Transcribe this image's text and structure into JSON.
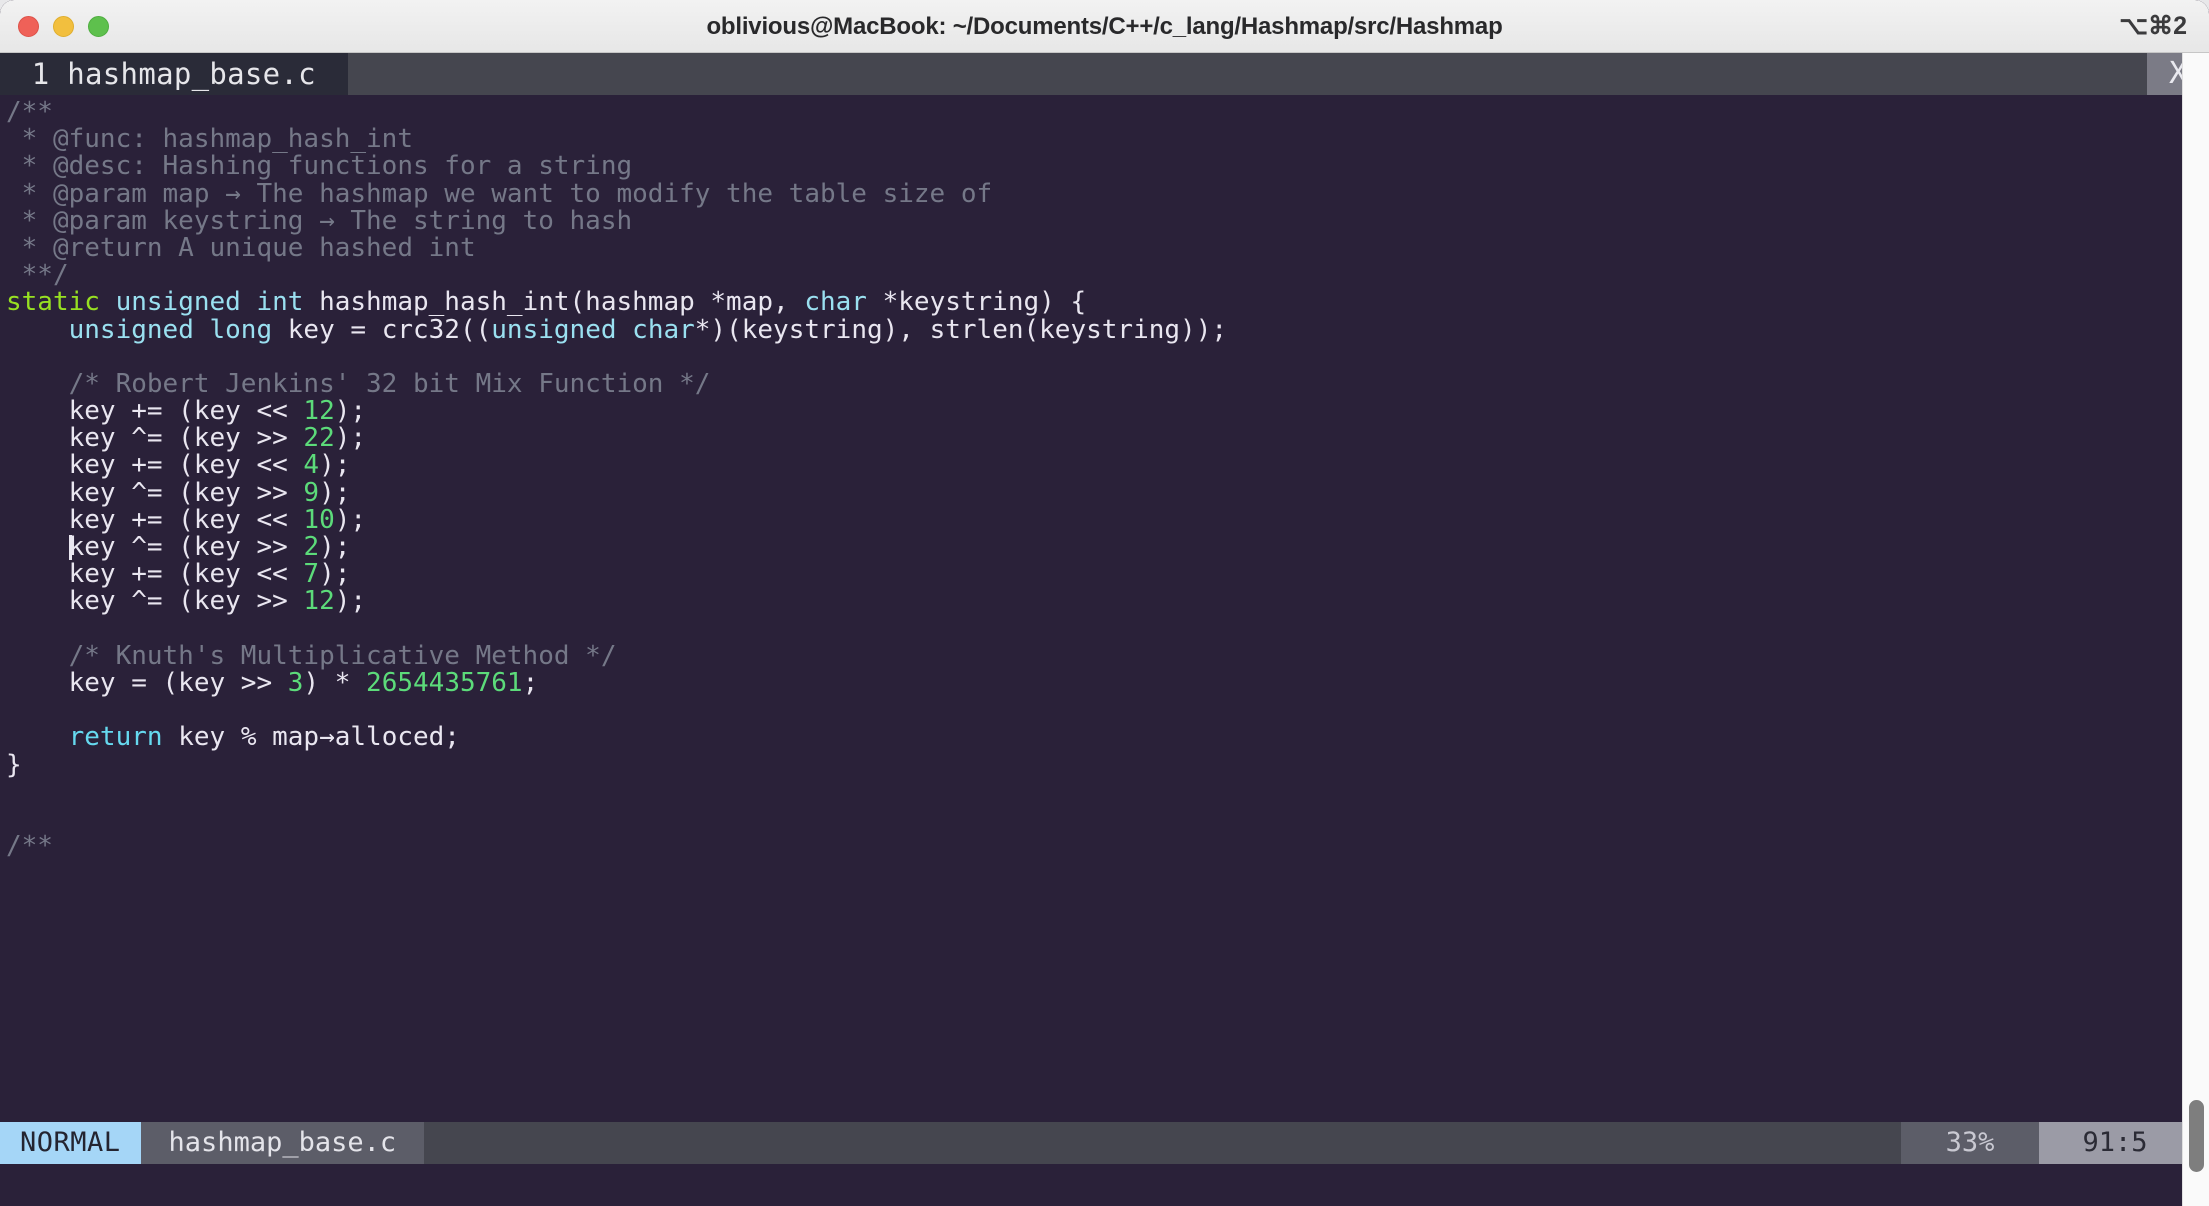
{
  "window": {
    "title": "oblivious@MacBook: ~/Documents/C++/c_lang/Hashmap/src/Hashmap",
    "shortcut": "⌥⌘2",
    "traffic_colors": {
      "close": "#ef6158",
      "minimize": "#f2bf3e",
      "zoom": "#5ec04d"
    },
    "background": "#2a2139"
  },
  "tabbar": {
    "tab_label": " 1 hashmap_base.c ",
    "close_label": "X"
  },
  "editor": {
    "lines": [
      {
        "segs": [
          {
            "t": "/**",
            "c": "cmt"
          }
        ]
      },
      {
        "segs": [
          {
            "t": " * @func: hashmap_hash_int",
            "c": "cmt"
          }
        ]
      },
      {
        "segs": [
          {
            "t": " * @desc: Hashing functions for a string",
            "c": "cmt"
          }
        ]
      },
      {
        "segs": [
          {
            "t": " * @param map → The hashmap we want to modify the table size of",
            "c": "cmt"
          }
        ]
      },
      {
        "segs": [
          {
            "t": " * @param keystring → The string to hash",
            "c": "cmt"
          }
        ]
      },
      {
        "segs": [
          {
            "t": " * @return A unique hashed int",
            "c": "cmt"
          }
        ]
      },
      {
        "segs": [
          {
            "t": " **/",
            "c": "cmt"
          }
        ]
      },
      {
        "segs": [
          {
            "t": "static",
            "c": "kw"
          },
          {
            "t": " ",
            "c": "fn"
          },
          {
            "t": "unsigned int",
            "c": "typ"
          },
          {
            "t": " hashmap_hash_int(hashmap *map, ",
            "c": "fn"
          },
          {
            "t": "char",
            "c": "typ"
          },
          {
            "t": " *keystring) {",
            "c": "fn"
          }
        ]
      },
      {
        "segs": [
          {
            "t": "    ",
            "c": "fn"
          },
          {
            "t": "unsigned long",
            "c": "typ"
          },
          {
            "t": " key = crc32((",
            "c": "fn"
          },
          {
            "t": "unsigned char",
            "c": "typ"
          },
          {
            "t": "*)(keystring), strlen(keystring));",
            "c": "fn"
          }
        ]
      },
      {
        "segs": [
          {
            "t": "",
            "c": "fn"
          }
        ]
      },
      {
        "segs": [
          {
            "t": "    /* Robert Jenkins' 32 bit Mix Function */",
            "c": "cmt"
          }
        ]
      },
      {
        "segs": [
          {
            "t": "    key += (key << ",
            "c": "fn"
          },
          {
            "t": "12",
            "c": "num"
          },
          {
            "t": ");",
            "c": "fn"
          }
        ]
      },
      {
        "segs": [
          {
            "t": "    key ^= (key >> ",
            "c": "fn"
          },
          {
            "t": "22",
            "c": "num"
          },
          {
            "t": ");",
            "c": "fn"
          }
        ]
      },
      {
        "segs": [
          {
            "t": "    key += (key << ",
            "c": "fn"
          },
          {
            "t": "4",
            "c": "num"
          },
          {
            "t": ");",
            "c": "fn"
          }
        ]
      },
      {
        "segs": [
          {
            "t": "    key ^= (key >> ",
            "c": "fn"
          },
          {
            "t": "9",
            "c": "num"
          },
          {
            "t": ");",
            "c": "fn"
          }
        ]
      },
      {
        "segs": [
          {
            "t": "    key += (key << ",
            "c": "fn"
          },
          {
            "t": "10",
            "c": "num"
          },
          {
            "t": ");",
            "c": "fn"
          }
        ]
      },
      {
        "segs": [
          {
            "t": "    ",
            "c": "fn"
          },
          {
            "caret": true
          },
          {
            "t": "key ^= (key >> ",
            "c": "fn"
          },
          {
            "t": "2",
            "c": "num"
          },
          {
            "t": ");",
            "c": "fn"
          }
        ]
      },
      {
        "segs": [
          {
            "t": "    key += (key << ",
            "c": "fn"
          },
          {
            "t": "7",
            "c": "num"
          },
          {
            "t": ");",
            "c": "fn"
          }
        ]
      },
      {
        "segs": [
          {
            "t": "    key ^= (key >> ",
            "c": "fn"
          },
          {
            "t": "12",
            "c": "num"
          },
          {
            "t": ");",
            "c": "fn"
          }
        ]
      },
      {
        "segs": [
          {
            "t": "",
            "c": "fn"
          }
        ]
      },
      {
        "segs": [
          {
            "t": "    /* Knuth's Multiplicative Method */",
            "c": "cmt"
          }
        ]
      },
      {
        "segs": [
          {
            "t": "    key = (key >> ",
            "c": "fn"
          },
          {
            "t": "3",
            "c": "num"
          },
          {
            "t": ") * ",
            "c": "fn"
          },
          {
            "t": "2654435761",
            "c": "num"
          },
          {
            "t": ";",
            "c": "fn"
          }
        ]
      },
      {
        "segs": [
          {
            "t": "",
            "c": "fn"
          }
        ]
      },
      {
        "segs": [
          {
            "t": "    ",
            "c": "fn"
          },
          {
            "t": "return",
            "c": "ret"
          },
          {
            "t": " key % map→alloced;",
            "c": "fn"
          }
        ]
      },
      {
        "segs": [
          {
            "t": "}",
            "c": "fn"
          }
        ]
      },
      {
        "segs": [
          {
            "t": "",
            "c": "fn"
          }
        ]
      },
      {
        "segs": [
          {
            "t": "",
            "c": "fn"
          }
        ]
      },
      {
        "segs": [
          {
            "t": "/**",
            "c": "cmt"
          }
        ]
      }
    ]
  },
  "statusline": {
    "mode": "NORMAL",
    "filename": "hashmap_base.c",
    "percent": "33%",
    "position": "91:5",
    "mode_bg": "#a5d6f7"
  }
}
